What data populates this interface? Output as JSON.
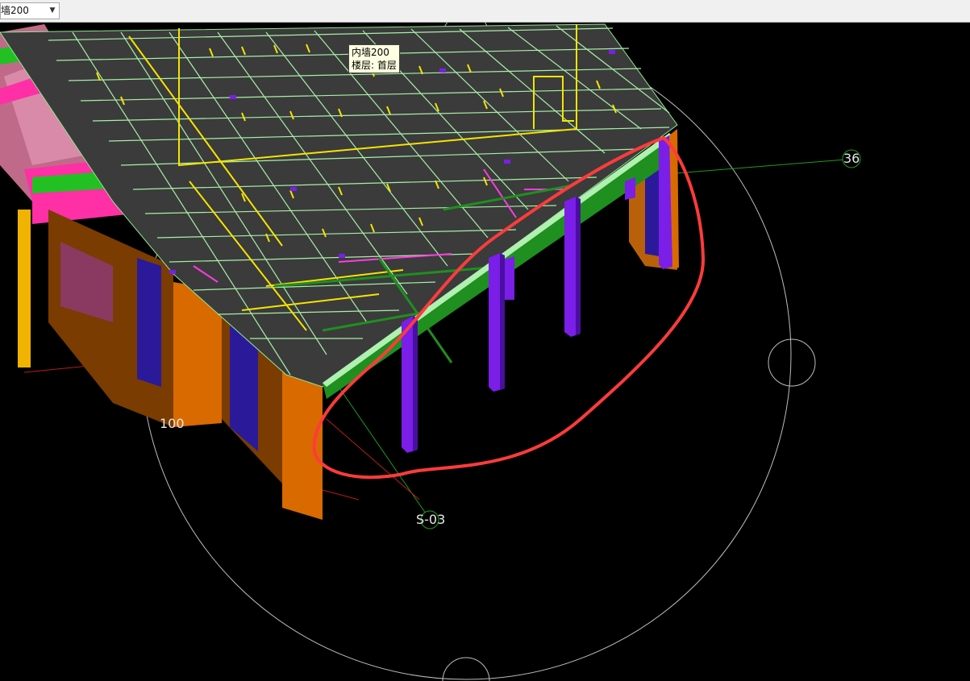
{
  "toolbar": {
    "component_select": {
      "value": "墙200"
    }
  },
  "tooltip": {
    "line1": "内墙200",
    "line2": "楼层: 首层"
  },
  "axis_labels": {
    "axis_36": "36",
    "axis_100": "100",
    "axis_s03": "S-03"
  },
  "colors": {
    "background": "#000000",
    "slab": "#3b3b3b",
    "rebar_grid": "#8fe88f",
    "rebar_yellow": "#f5e400",
    "beam_green": "#1f8f1f",
    "column_purple": "#7a1ee8",
    "wall_orange": "#d96a00",
    "pink_wall": "#ff3cb4",
    "highlight_circle": "#ff3b3b"
  },
  "icons": {
    "dropdown": "chevron-down-icon"
  }
}
